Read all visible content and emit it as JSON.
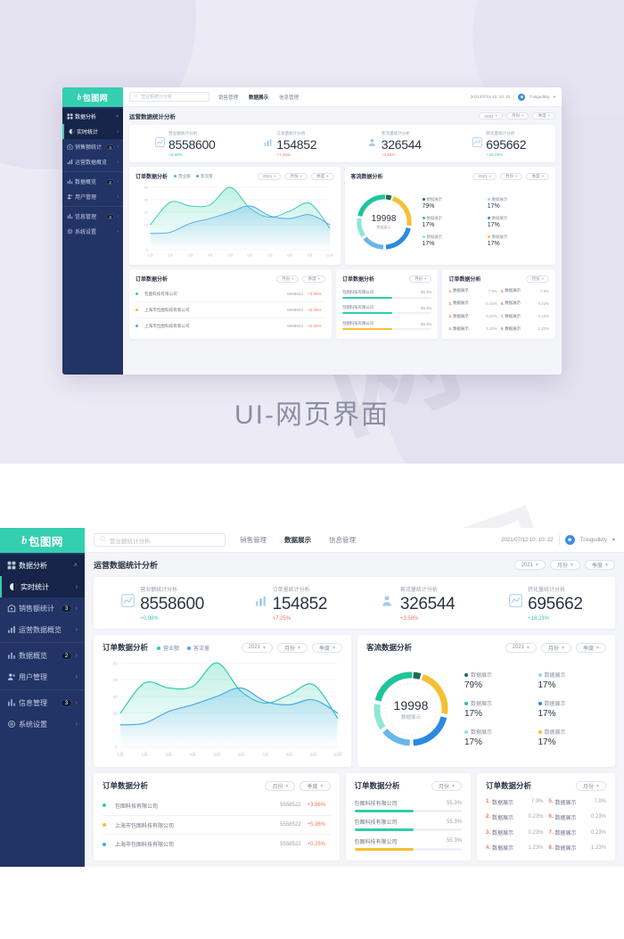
{
  "caption": "UI-网页界面",
  "watermarks": [
    "包图网",
    "包图网",
    "包图网"
  ],
  "brand": {
    "logo_mark": "b",
    "logo_text": "包图网",
    "logo_bg": "#34cfb0",
    "sidebar_bg": "#213465",
    "accent": "#34cfb0"
  },
  "sidebar": {
    "groups": [
      {
        "items": [
          {
            "label": "数据分析",
            "icon": "dashboard-icon",
            "badge": "",
            "chevron": "˄",
            "active": true,
            "accent": false
          },
          {
            "label": "实时统计",
            "icon": "clock-icon",
            "badge": "",
            "chevron": "›",
            "active": true,
            "accent": true
          },
          {
            "label": "销售额统计",
            "icon": "store-icon",
            "badge": "3",
            "chevron": "›",
            "active": false,
            "accent": false
          },
          {
            "label": "运营数据概览",
            "icon": "bar-chart-icon",
            "badge": "",
            "chevron": "›",
            "active": false,
            "accent": false
          }
        ]
      },
      {
        "items": [
          {
            "label": "数据概览",
            "icon": "chart-icon",
            "badge": "2",
            "chevron": "›",
            "active": false,
            "accent": false
          },
          {
            "label": "用户管理",
            "icon": "users-icon",
            "badge": "",
            "chevron": "›",
            "active": false,
            "accent": false
          }
        ]
      },
      {
        "items": [
          {
            "label": "信息管理",
            "icon": "list-chart-icon",
            "badge": "3",
            "chevron": "›",
            "active": false,
            "accent": false
          },
          {
            "label": "系统设置",
            "icon": "gear-icon",
            "badge": "",
            "chevron": "›",
            "active": false,
            "accent": false
          }
        ]
      }
    ]
  },
  "topbar": {
    "search_placeholder": "营业额统计分析",
    "search_value": "",
    "nav": [
      {
        "label": "销售管理",
        "active": false
      },
      {
        "label": "数据展示",
        "active": true
      },
      {
        "label": "信息管理",
        "active": false
      }
    ],
    "datetime": "2021/07/12 10: 10: 22",
    "username": "Tnisgudkity",
    "user_caret": "▾"
  },
  "page": {
    "title": "运营数据统计分析",
    "filters": [
      {
        "label": "2021",
        "caret": "▾"
      },
      {
        "label": "月份",
        "caret": "▾"
      },
      {
        "label": "季度",
        "caret": "▾"
      }
    ]
  },
  "kpis": [
    {
      "label": "营业额统计分析",
      "value": "8558600",
      "delta": "+0.98%",
      "delta_color": "#3ec9a7",
      "icon": "line-chart-icon",
      "icon_color": "#8fb6e8"
    },
    {
      "label": "订单量统计分析",
      "value": "154852",
      "delta": "+7.25%",
      "delta_color": "#f2795a",
      "icon": "bar-chart-icon",
      "icon_color": "#8fb6e8"
    },
    {
      "label": "客流量统计分析",
      "value": "326544",
      "delta": "+3.58%",
      "delta_color": "#f2795a",
      "icon": "user-icon",
      "icon_color": "#8fb6e8"
    },
    {
      "label": "转化量统计分析",
      "value": "695662",
      "delta": "+18.23%",
      "delta_color": "#3ec9a7",
      "icon": "trend-icon",
      "icon_color": "#8fb6e8"
    }
  ],
  "line_card": {
    "title": "订单数据分析",
    "legend": [
      {
        "label": "营业额",
        "color": "#2ecfa9"
      },
      {
        "label": "客流量",
        "color": "#4aa8ea"
      }
    ],
    "filters": [
      {
        "label": "2021",
        "caret": "▾"
      },
      {
        "label": "月份",
        "caret": "▾"
      },
      {
        "label": "季度",
        "caret": "▾"
      }
    ]
  },
  "donut_card": {
    "title": "客流数据分析",
    "center_value": "19998",
    "center_label": "数据展示",
    "filters": [
      {
        "label": "2021",
        "caret": "▾"
      },
      {
        "label": "月份",
        "caret": "▾"
      },
      {
        "label": "季度",
        "caret": "▾"
      }
    ],
    "legend": [
      {
        "name": "数据展示",
        "value": "79%",
        "color": "#1e6b52"
      },
      {
        "name": "数据展示",
        "value": "17%",
        "color": "#8fd7f5"
      },
      {
        "name": "数据展示",
        "value": "17%",
        "color": "#1fc49b"
      },
      {
        "name": "数据展示",
        "value": "17%",
        "color": "#2b8ae0"
      },
      {
        "name": "数据展示",
        "value": "17%",
        "color": "#8fe6d6"
      },
      {
        "name": "数据展示",
        "value": "17%",
        "color": "#f5c033"
      }
    ]
  },
  "bottom_left": {
    "title": "订单数据分析",
    "filters": [
      {
        "label": "月份",
        "caret": "▾"
      },
      {
        "label": "季度",
        "caret": "▾"
      }
    ],
    "rows": [
      {
        "dot": "#2ecfa9",
        "name": "包图科技有限公司",
        "num": "5558522",
        "pct": "+3.96%"
      },
      {
        "dot": "#f5c033",
        "name": "上海市包图科技有限公司",
        "num": "5558522",
        "pct": "+5.36%"
      },
      {
        "dot": "#4aa8ea",
        "name": "上海市包图科技有限公司",
        "num": "5558522",
        "pct": "+0.25%"
      }
    ]
  },
  "bottom_mid": {
    "title": "订单数据分析",
    "filters": [
      {
        "label": "月份",
        "caret": "▾"
      }
    ],
    "rows": [
      {
        "name": "包图科技有限公司",
        "pct": "55.3%",
        "fill": 55.3,
        "color": "#2ecfa9"
      },
      {
        "name": "包图科技有限公司",
        "pct": "55.3%",
        "fill": 55.3,
        "color": "#2ecfa9"
      },
      {
        "name": "包图科技有限公司",
        "pct": "55.3%",
        "fill": 55.3,
        "color": "#f5c033"
      }
    ]
  },
  "bottom_right": {
    "title": "订单数据分析",
    "filters": [
      {
        "label": "月份",
        "caret": "▾"
      }
    ],
    "rows": [
      {
        "index": "1.",
        "name": "数据展示",
        "value": "7.9%"
      },
      {
        "index": "5.",
        "name": "数据展示",
        "value": "7.9%"
      },
      {
        "index": "2.",
        "name": "数据展示",
        "value": "0.23%"
      },
      {
        "index": "6.",
        "name": "数据展示",
        "value": "0.23%"
      },
      {
        "index": "3.",
        "name": "数据展示",
        "value": "0.23%"
      },
      {
        "index": "7.",
        "name": "数据展示",
        "value": "0.23%"
      },
      {
        "index": "4.",
        "name": "数据展示",
        "value": "1.23%"
      },
      {
        "index": "8.",
        "name": "数据展示",
        "value": "1.23%"
      }
    ]
  },
  "chart_data": [
    {
      "type": "area",
      "title": "订单数据分析",
      "xlabel": "",
      "ylabel": "",
      "ylim": [
        0,
        50
      ],
      "yticks": [
        0,
        20,
        30,
        40,
        50
      ],
      "grid": true,
      "legend_position": "top-left",
      "categories": [
        "1月",
        "2月",
        "3月",
        "4月",
        "5月",
        "6月",
        "7月",
        "8月",
        "9月",
        "10月"
      ],
      "series": [
        {
          "name": "营业额",
          "color": "#2ecfa9",
          "values": [
            20,
            38,
            35,
            36,
            50,
            33,
            26,
            31,
            37,
            17
          ]
        },
        {
          "name": "客流量",
          "color": "#4aa8ea",
          "values": [
            13,
            14,
            21,
            25,
            30,
            35,
            27,
            25,
            28,
            20
          ]
        }
      ]
    },
    {
      "type": "pie",
      "title": "客流数据分析",
      "center_value": "19998",
      "center_label": "数据展示",
      "labels": [
        "数据展示",
        "数据展示",
        "数据展示",
        "数据展示",
        "数据展示",
        "数据展示"
      ],
      "values": [
        79,
        17,
        17,
        17,
        17,
        17
      ],
      "colors": [
        "#1e6b52",
        "#f5c033",
        "#2b8ae0",
        "#6ab6ea",
        "#8fe6d6",
        "#1fc49b"
      ],
      "legend_position": "right"
    }
  ]
}
